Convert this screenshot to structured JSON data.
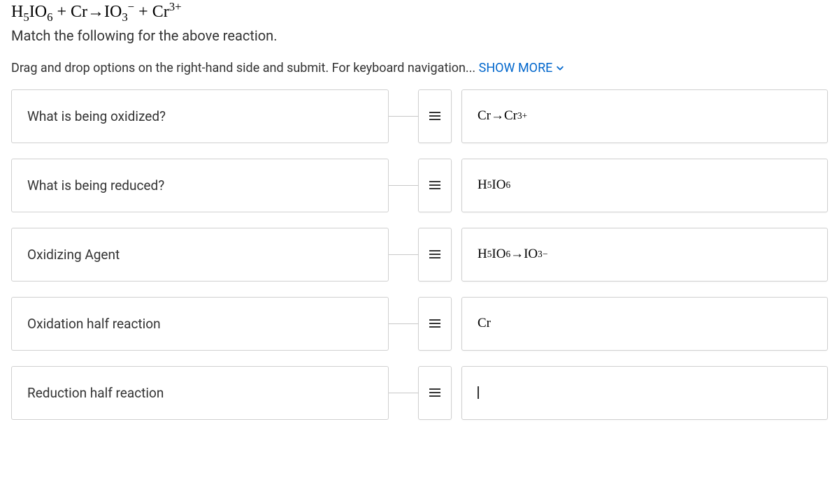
{
  "header": {
    "equation_html": "H<sub>5</sub>IO<sub>6</sub> + Cr→IO<sub>3</sub><sup>−</sup> + Cr<sup>3+</sup>",
    "instruction": "Match the following for the above reaction."
  },
  "subinstruction": {
    "text": "Drag and drop options on the right-hand side and submit. For keyboard navigation... ",
    "show_more_label": "SHOW MORE"
  },
  "rows": [
    {
      "prompt": "What is being oxidized?",
      "answer_html": "Cr→Cr<sup>3+</sup>"
    },
    {
      "prompt": "What is being reduced?",
      "answer_html": "H<sub>5</sub>IO<sub>6</sub>"
    },
    {
      "prompt": "Oxidizing Agent",
      "answer_html": "H<sub>5</sub>IO<sub>6</sub>→IO<sub>3</sub><sup>−</sup>"
    },
    {
      "prompt": "Oxidation half reaction",
      "answer_html": "Cr"
    },
    {
      "prompt": "Reduction half reaction",
      "answer_html": "<span class=\"cursor\"></span>"
    }
  ]
}
